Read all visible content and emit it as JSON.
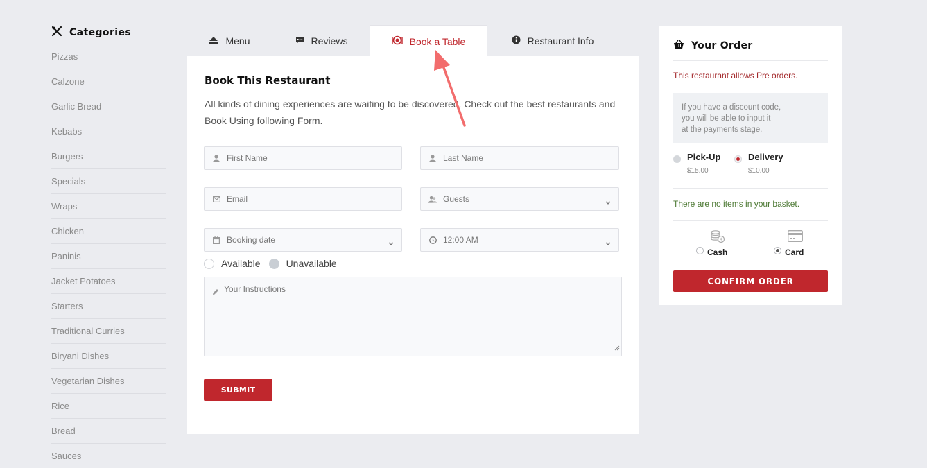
{
  "sidebar": {
    "title": "Categories",
    "items": [
      "Pizzas",
      "Calzone",
      "Garlic Bread",
      "Kebabs",
      "Burgers",
      "Specials",
      "Wraps",
      "Chicken",
      "Paninis",
      "Jacket Potatoes",
      "Starters",
      "Traditional Curries",
      "Biryani Dishes",
      "Vegetarian Dishes",
      "Rice",
      "Bread",
      "Sauces"
    ]
  },
  "tabs": {
    "menu": "Menu",
    "reviews": "Reviews",
    "book": "Book a Table",
    "info": "Restaurant Info"
  },
  "booking": {
    "title": "Book This Restaurant",
    "description": "All kinds of dining experiences are waiting to be discovered. Check out the best restaurants and Book Using following Form.",
    "first_name_placeholder": "First Name",
    "last_name_placeholder": "Last Name",
    "email_placeholder": "Email",
    "guests_placeholder": "Guests",
    "date_placeholder": "Booking date",
    "time_value": "12:00 AM",
    "available_label": "Available",
    "unavailable_label": "Unavailable",
    "instructions_placeholder": "Your Instructions",
    "submit_label": "SUBMIT"
  },
  "order": {
    "title": "Your Order",
    "pre_orders": "This restaurant allows Pre orders.",
    "discount_line1": "If you have a discount code,",
    "discount_line2": "you will be able to input it",
    "discount_line3": "at the payments stage.",
    "pickup_label": "Pick-Up",
    "pickup_price": "$15.00",
    "delivery_label": "Delivery",
    "delivery_price": "$10.00",
    "basket_msg": "There are no items in your basket.",
    "cash_label": "Cash",
    "card_label": "Card",
    "confirm_label": "CONFIRM ORDER"
  },
  "colors": {
    "accent": "#c0272d",
    "background": "#ebecf0",
    "success_text": "#4e7a35",
    "annotation_arrow": "#f26d6d"
  }
}
